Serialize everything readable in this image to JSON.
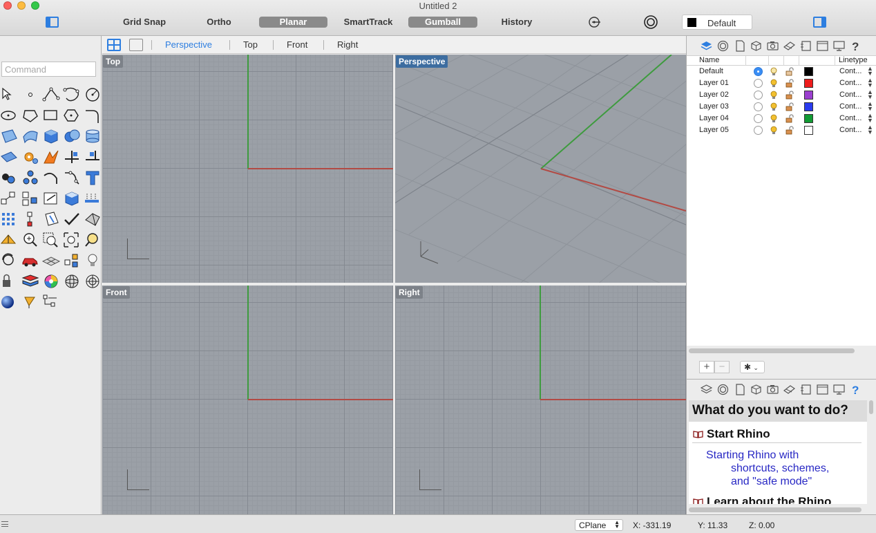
{
  "window": {
    "title": "Untitled 2"
  },
  "toolbar": {
    "buttons": [
      {
        "label": "Grid Snap",
        "on": false
      },
      {
        "label": "Ortho",
        "on": false
      },
      {
        "label": "Planar",
        "on": true
      },
      {
        "label": "SmartTrack",
        "on": false
      },
      {
        "label": "Gumball",
        "on": true
      },
      {
        "label": "History",
        "on": false
      }
    ],
    "current_layer": "Default"
  },
  "command": {
    "placeholder": "Command"
  },
  "viewport_tabs": [
    "Perspective",
    "Top",
    "Front",
    "Right"
  ],
  "viewports": {
    "top": "Top",
    "perspective": "Perspective",
    "front": "Front",
    "right": "Right"
  },
  "layers": {
    "headers": {
      "name": "Name",
      "linetype": "Linetype"
    },
    "rows": [
      {
        "name": "Default",
        "current": true,
        "color": "#000000",
        "linetype": "Cont..."
      },
      {
        "name": "Layer 01",
        "current": false,
        "color": "#ee1c1c",
        "linetype": "Cont..."
      },
      {
        "name": "Layer 02",
        "current": false,
        "color": "#9b3fcf",
        "linetype": "Cont..."
      },
      {
        "name": "Layer 03",
        "current": false,
        "color": "#2a3bef",
        "linetype": "Cont..."
      },
      {
        "name": "Layer 04",
        "current": false,
        "color": "#119b33",
        "linetype": "Cont..."
      },
      {
        "name": "Layer 05",
        "current": false,
        "color": "#ffffff",
        "linetype": "Cont..."
      }
    ]
  },
  "help": {
    "heading": "What do you want to do?",
    "section": "Start Rhino",
    "link_line1": "Starting Rhino with",
    "link_line2": "shortcuts, schemes,",
    "link_line3": "and \"safe mode\"",
    "next_section": "Learn about the Rhino"
  },
  "status": {
    "cplane": "CPlane",
    "x": "X: -331.19",
    "y": "Y: 11.33",
    "z": "Z: 0.00"
  },
  "colors": {
    "accent": "#2d7ee0",
    "x_axis": "#b24a44",
    "y_axis": "#3e9b3e",
    "viewport_bg": "#9ba0a7"
  }
}
